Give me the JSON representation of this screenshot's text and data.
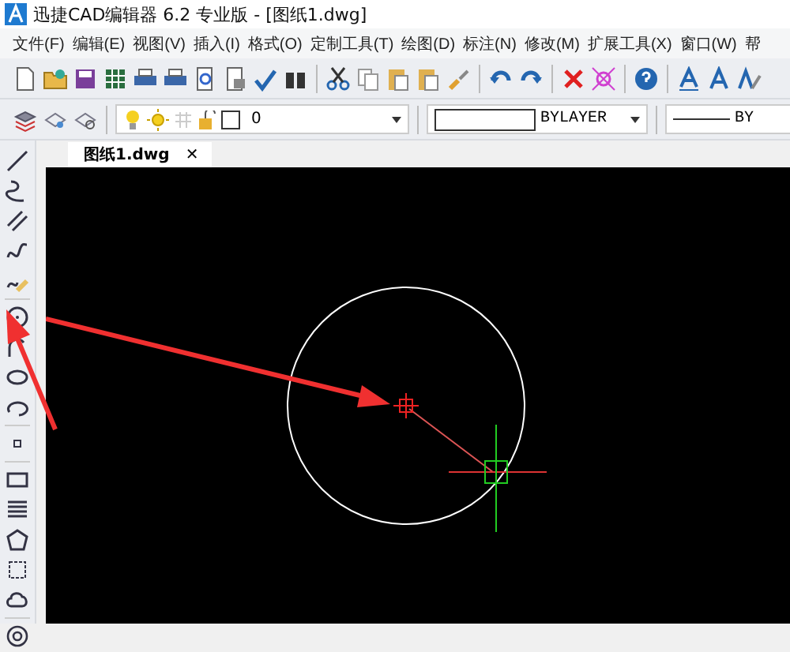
{
  "window": {
    "title": "迅捷CAD编辑器 6.2 专业版  - [图纸1.dwg]"
  },
  "menu": [
    "文件(F)",
    "编辑(E)",
    "视图(V)",
    "插入(I)",
    "格式(O)",
    "定制工具(T)",
    "绘图(D)",
    "标注(N)",
    "修改(M)",
    "扩展工具(X)",
    "窗口(W)",
    "帮"
  ],
  "properties_bar": {
    "layer": "0",
    "color_value": "BYLAYER",
    "linetype": "BY"
  },
  "tabs": [
    {
      "label": "图纸1.dwg",
      "selected": true,
      "close": "✕"
    }
  ]
}
